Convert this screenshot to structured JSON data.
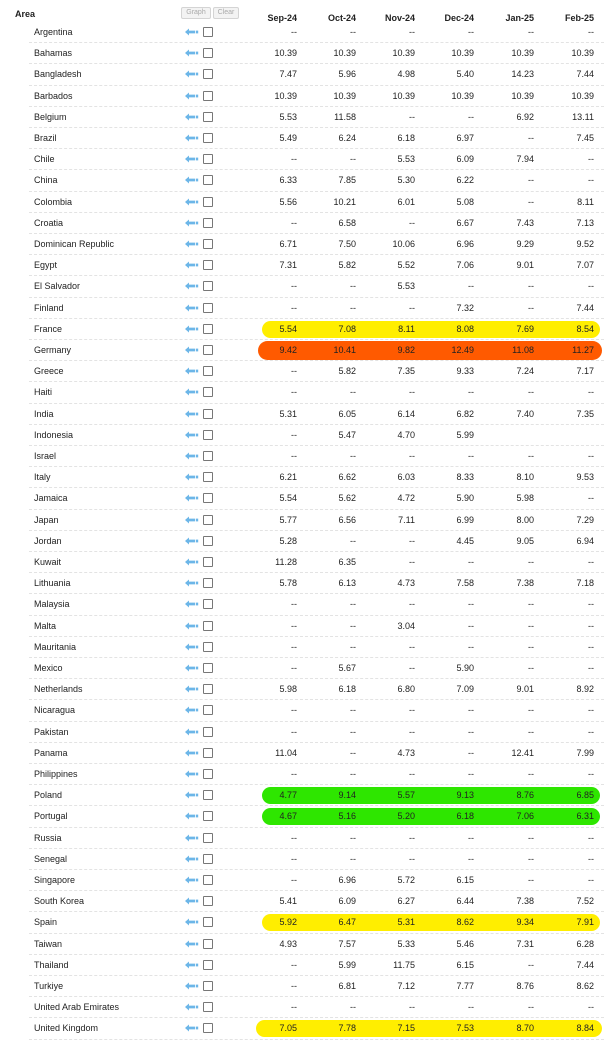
{
  "header": {
    "area_label": "Area",
    "graph_button": "Graph",
    "clear_button": "Clear",
    "columns": [
      "Sep-24",
      "Oct-24",
      "Nov-24",
      "Dec-24",
      "Jan-25",
      "Feb-25"
    ]
  },
  "highlight_colors": {
    "yellow": "#ffee00",
    "orange": "#ff5a00",
    "green": "#2ee600"
  },
  "icons": {
    "row_icon": "arrow-left-icon",
    "checkbox": "checkbox-icon"
  },
  "rows": [
    {
      "area": "Argentina",
      "values": [
        "--",
        "--",
        "--",
        "--",
        "--",
        "--"
      ]
    },
    {
      "area": "Bahamas",
      "values": [
        "10.39",
        "10.39",
        "10.39",
        "10.39",
        "10.39",
        "10.39"
      ]
    },
    {
      "area": "Bangladesh",
      "values": [
        "7.47",
        "5.96",
        "4.98",
        "5.40",
        "14.23",
        "7.44"
      ]
    },
    {
      "area": "Barbados",
      "values": [
        "10.39",
        "10.39",
        "10.39",
        "10.39",
        "10.39",
        "10.39"
      ]
    },
    {
      "area": "Belgium",
      "values": [
        "5.53",
        "11.58",
        "--",
        "--",
        "6.92",
        "13.11"
      ]
    },
    {
      "area": "Brazil",
      "values": [
        "5.49",
        "6.24",
        "6.18",
        "6.97",
        "--",
        "7.45"
      ]
    },
    {
      "area": "Chile",
      "values": [
        "--",
        "--",
        "5.53",
        "6.09",
        "7.94",
        "--"
      ]
    },
    {
      "area": "China",
      "values": [
        "6.33",
        "7.85",
        "5.30",
        "6.22",
        "--",
        "--"
      ]
    },
    {
      "area": "Colombia",
      "values": [
        "5.56",
        "10.21",
        "6.01",
        "5.08",
        "--",
        "8.11"
      ]
    },
    {
      "area": "Croatia",
      "values": [
        "--",
        "6.58",
        "--",
        "6.67",
        "7.43",
        "7.13"
      ]
    },
    {
      "area": "Dominican Republic",
      "values": [
        "6.71",
        "7.50",
        "10.06",
        "6.96",
        "9.29",
        "9.52"
      ]
    },
    {
      "area": "Egypt",
      "values": [
        "7.31",
        "5.82",
        "5.52",
        "7.06",
        "9.01",
        "7.07"
      ]
    },
    {
      "area": "El Salvador",
      "values": [
        "--",
        "--",
        "5.53",
        "--",
        "--",
        "--"
      ]
    },
    {
      "area": "Finland",
      "values": [
        "--",
        "--",
        "--",
        "7.32",
        "--",
        "7.44"
      ]
    },
    {
      "area": "France",
      "values": [
        "5.54",
        "7.08",
        "8.11",
        "8.08",
        "7.69",
        "8.54"
      ],
      "highlight": "yellow"
    },
    {
      "area": "Germany",
      "values": [
        "9.42",
        "10.41",
        "9.82",
        "12.49",
        "11.08",
        "11.27"
      ],
      "highlight": "orange"
    },
    {
      "area": "Greece",
      "values": [
        "--",
        "5.82",
        "7.35",
        "9.33",
        "7.24",
        "7.17"
      ]
    },
    {
      "area": "Haiti",
      "values": [
        "--",
        "--",
        "--",
        "--",
        "--",
        "--"
      ]
    },
    {
      "area": "India",
      "values": [
        "5.31",
        "6.05",
        "6.14",
        "6.82",
        "7.40",
        "7.35"
      ]
    },
    {
      "area": "Indonesia",
      "values": [
        "--",
        "5.47",
        "4.70",
        "5.99",
        "",
        ""
      ]
    },
    {
      "area": "Israel",
      "values": [
        "--",
        "--",
        "--",
        "--",
        "--",
        "--"
      ]
    },
    {
      "area": "Italy",
      "values": [
        "6.21",
        "6.62",
        "6.03",
        "8.33",
        "8.10",
        "9.53"
      ]
    },
    {
      "area": "Jamaica",
      "values": [
        "5.54",
        "5.62",
        "4.72",
        "5.90",
        "5.98",
        "--"
      ]
    },
    {
      "area": "Japan",
      "values": [
        "5.77",
        "6.56",
        "7.11",
        "6.99",
        "8.00",
        "7.29"
      ]
    },
    {
      "area": "Jordan",
      "values": [
        "5.28",
        "--",
        "--",
        "4.45",
        "9.05",
        "6.94"
      ]
    },
    {
      "area": "Kuwait",
      "values": [
        "11.28",
        "6.35",
        "--",
        "--",
        "--",
        "--"
      ]
    },
    {
      "area": "Lithuania",
      "values": [
        "5.78",
        "6.13",
        "4.73",
        "7.58",
        "7.38",
        "7.18"
      ]
    },
    {
      "area": "Malaysia",
      "values": [
        "--",
        "--",
        "--",
        "--",
        "--",
        "--"
      ]
    },
    {
      "area": "Malta",
      "values": [
        "--",
        "--",
        "3.04",
        "--",
        "--",
        "--"
      ]
    },
    {
      "area": "Mauritania",
      "values": [
        "--",
        "--",
        "--",
        "--",
        "--",
        "--"
      ]
    },
    {
      "area": "Mexico",
      "values": [
        "--",
        "5.67",
        "--",
        "5.90",
        "--",
        "--"
      ]
    },
    {
      "area": "Netherlands",
      "values": [
        "5.98",
        "6.18",
        "6.80",
        "7.09",
        "9.01",
        "8.92"
      ]
    },
    {
      "area": "Nicaragua",
      "values": [
        "--",
        "--",
        "--",
        "--",
        "--",
        "--"
      ]
    },
    {
      "area": "Pakistan",
      "values": [
        "--",
        "--",
        "--",
        "--",
        "--",
        "--"
      ]
    },
    {
      "area": "Panama",
      "values": [
        "11.04",
        "--",
        "4.73",
        "--",
        "12.41",
        "7.99"
      ]
    },
    {
      "area": "Philippines",
      "values": [
        "--",
        "--",
        "--",
        "--",
        "--",
        "--"
      ]
    },
    {
      "area": "Poland",
      "values": [
        "4.77",
        "9.14",
        "5.57",
        "9.13",
        "8.76",
        "6.85"
      ],
      "highlight": "green"
    },
    {
      "area": "Portugal",
      "values": [
        "4.67",
        "5.16",
        "5.20",
        "6.18",
        "7.06",
        "6.31"
      ],
      "highlight": "green"
    },
    {
      "area": "Russia",
      "values": [
        "--",
        "--",
        "--",
        "--",
        "--",
        "--"
      ]
    },
    {
      "area": "Senegal",
      "values": [
        "--",
        "--",
        "--",
        "--",
        "--",
        "--"
      ]
    },
    {
      "area": "Singapore",
      "values": [
        "--",
        "6.96",
        "5.72",
        "6.15",
        "--",
        "--"
      ]
    },
    {
      "area": "South Korea",
      "values": [
        "5.41",
        "6.09",
        "6.27",
        "6.44",
        "7.38",
        "7.52"
      ]
    },
    {
      "area": "Spain",
      "values": [
        "5.92",
        "6.47",
        "5.31",
        "8.62",
        "9.34",
        "7.91"
      ],
      "highlight": "yellow"
    },
    {
      "area": "Taiwan",
      "values": [
        "4.93",
        "7.57",
        "5.33",
        "5.46",
        "7.31",
        "6.28"
      ]
    },
    {
      "area": "Thailand",
      "values": [
        "--",
        "5.99",
        "11.75",
        "6.15",
        "--",
        "7.44"
      ]
    },
    {
      "area": "Turkiye",
      "values": [
        "--",
        "6.81",
        "7.12",
        "7.77",
        "8.76",
        "8.62"
      ]
    },
    {
      "area": "United Arab Emirates",
      "values": [
        "--",
        "--",
        "--",
        "--",
        "--",
        "--"
      ]
    },
    {
      "area": "United Kingdom",
      "values": [
        "7.05",
        "7.78",
        "7.15",
        "7.53",
        "8.70",
        "8.84"
      ],
      "highlight": "yellow"
    }
  ]
}
